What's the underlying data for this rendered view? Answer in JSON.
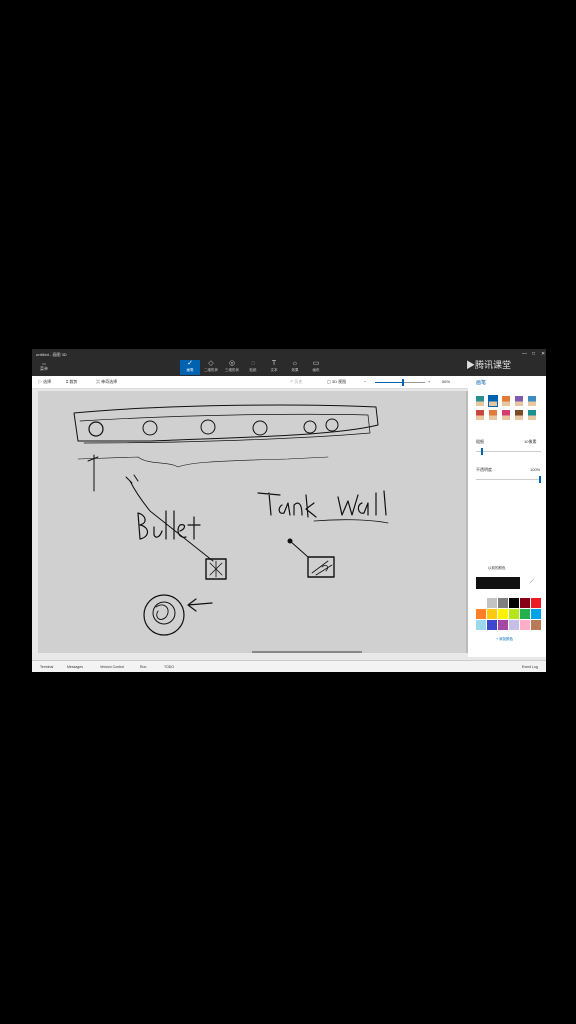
{
  "window": {
    "title": "untitled - 画图 3D",
    "controls": [
      "—",
      "□",
      "✕"
    ]
  },
  "menu": {
    "label": "菜单"
  },
  "tools": [
    {
      "label": "画笔",
      "icon": "brush-icon",
      "glyph": "✓"
    },
    {
      "label": "二维形状",
      "icon": "shapes-2d-icon",
      "glyph": "◇"
    },
    {
      "label": "三维形状",
      "icon": "shapes-3d-icon",
      "glyph": "◎"
    },
    {
      "label": "贴纸",
      "icon": "sticker-icon",
      "glyph": "◌"
    },
    {
      "label": "文本",
      "icon": "text-icon",
      "glyph": "T"
    },
    {
      "label": "效果",
      "icon": "effects-icon",
      "glyph": "☼"
    },
    {
      "label": "画布",
      "icon": "canvas-icon",
      "glyph": "▭"
    }
  ],
  "watermark": "腾讯课堂",
  "toolbar2": {
    "select": "选择",
    "crop": "裁剪",
    "magic_select": "神奇选择",
    "history": "历史",
    "view_3d": "3D 视图",
    "zoom_percent": "56%"
  },
  "panel": {
    "title": "画笔",
    "thickness_label": "粗细",
    "thickness_value": "10像素",
    "opacity_label": "不透明度",
    "opacity_value": "100%",
    "color_label": "以前的颜色",
    "add_color": "+ 添加颜色",
    "thickness_level": 0.08,
    "opacity_level": 1.0,
    "palette": [
      "#ffffff",
      "#c3c3c3",
      "#7f7f7f",
      "#000000",
      "#880015",
      "#ed1c24",
      "#ff7f27",
      "#ffc90e",
      "#fff200",
      "#b5e61d",
      "#22b14c",
      "#00a2e8",
      "#99d9ea",
      "#3f48cc",
      "#a349a4",
      "#c8bfe7",
      "#ffaec9",
      "#b97a57"
    ],
    "brush_colors": [
      "#2a8f8f",
      "#0063b1",
      "#e07b39",
      "#7e5bb0",
      "#3a8cc1",
      "#c8473c",
      "#e07b39",
      "#d53b6f",
      "#7a4a2b",
      "#1c8f8f"
    ]
  },
  "statusbar": {
    "items": [
      "Terminal",
      "Messages",
      "Version Control",
      "Run",
      "TODO"
    ],
    "right": "Event Log"
  },
  "canvas": {
    "labels": [
      "Bullet",
      "Tank",
      "Wall"
    ]
  }
}
